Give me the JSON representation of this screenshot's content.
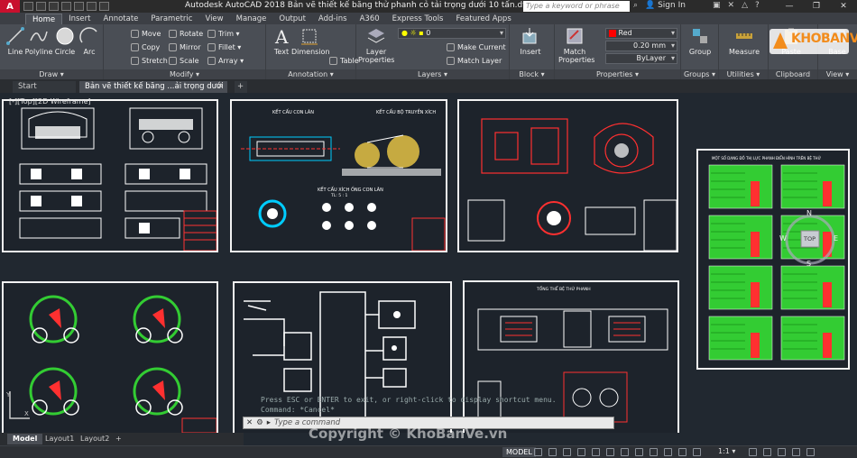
{
  "titlebar": {
    "app_logo": "A",
    "title": "Autodesk AutoCAD 2018     Bản vẽ thiết kế băng thử phanh cỏ tải trọng dưới 10 tấn.dwg",
    "search_placeholder": "Type a keyword or phrase",
    "signin": "Sign In"
  },
  "ribbon_tabs": [
    "Home",
    "Insert",
    "Annotate",
    "Parametric",
    "View",
    "Manage",
    "Output",
    "Add-ins",
    "A360",
    "Express Tools",
    "Featured Apps"
  ],
  "ribbon": {
    "draw": {
      "title": "Draw ▾",
      "line": "Line",
      "polyline": "Polyline",
      "circle": "Circle",
      "arc": "Arc"
    },
    "modify": {
      "title": "Modify ▾",
      "move": "Move",
      "rotate": "Rotate",
      "trim": "Trim ▾",
      "copy": "Copy",
      "mirror": "Mirror",
      "fillet": "Fillet ▾",
      "stretch": "Stretch",
      "scale": "Scale",
      "array": "Array ▾"
    },
    "annotation": {
      "title": "Annotation ▾",
      "text": "Text",
      "dimension": "Dimension",
      "table": "Table"
    },
    "layers": {
      "title": "Layers ▾",
      "layer_properties": "Layer Properties",
      "layer_value": "0",
      "make_current": "Make Current",
      "match_layer": "Match Layer"
    },
    "block": {
      "title": "Block ▾",
      "insert": "Insert"
    },
    "properties": {
      "title": "Properties ▾",
      "match": "Match Properties",
      "color": "Red",
      "lineweight": "0.20 mm",
      "linetype": "ByLayer"
    },
    "groups": {
      "title": "Groups ▾",
      "group": "Group"
    },
    "utilities": {
      "title": "Utilities ▾",
      "measure": "Measure"
    },
    "clipboard": {
      "title": "Clipboard",
      "paste": "Paste"
    },
    "view": {
      "title": "View ▾",
      "base": "Base"
    }
  },
  "doc_tabs": {
    "start": "Start",
    "drawing": "Bản vẽ thiết kế băng ...ải trọng dưới 10 tấn*",
    "add": "+"
  },
  "viewport_label": "[-][Top][2D Wireframe]",
  "sheets": {
    "s2_title_left": "KẾT CẤU CON LĂN",
    "s2_title_right": "KẾT CẤU BỘ TRUYỀN XÍCH",
    "s2_sub": "KẾT CẤU XÍCH ỐNG CON LĂN",
    "s2_scale": "TL: 5 : 1",
    "s8_title": "TỔNG THỂ BỆ THỬ PHANH",
    "s5_title": "MỘT SỐ DẠNG ĐỒ THỊ LỰC PHANH ĐIỂN HÌNH TRÊN BỆ THỬ"
  },
  "viewcube": {
    "n": "N",
    "s": "S",
    "e": "E",
    "w": "W",
    "top": "TOP",
    "wcs": "WCS"
  },
  "command": {
    "history1": "Press ESC or ENTER to exit, or right-click to display shortcut menu.",
    "history2": "Command: *Cancel*",
    "placeholder": "Type a command"
  },
  "layout_tabs": [
    "Model",
    "Layout1",
    "Layout2",
    "+"
  ],
  "status": {
    "model": "MODEL",
    "scale": "1:1 ▾"
  },
  "watermark": "Copyright © KhoBanVe.vn",
  "logo_text": "KHOBANVE",
  "colors": {
    "accent": "#c8102e",
    "green": "#33cc33",
    "red": "#ff3030",
    "cyan": "#00d0ff",
    "sheet_border": "#f2f2f2"
  }
}
